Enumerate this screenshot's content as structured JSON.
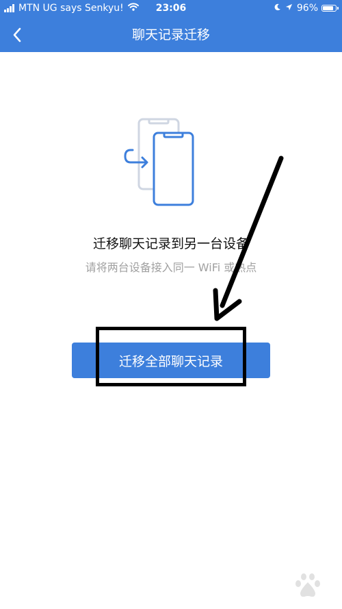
{
  "status_bar": {
    "carrier": "MTN UG says Senkyu!",
    "time": "23:06",
    "battery": "96%",
    "battery_level": 0.96
  },
  "nav": {
    "title": "聊天记录迁移",
    "back_icon": "chevron-left-icon"
  },
  "content": {
    "title": "迁移聊天记录到另一台设备",
    "subtitle": "请将两台设备接入同一 WiFi 或热点",
    "illustration_icon": "phone-transfer-icon"
  },
  "action": {
    "button_label": "迁移全部聊天记录"
  },
  "colors": {
    "primary": "#3d7fdc",
    "text": "#111111",
    "subtext": "#a0a0a0"
  }
}
